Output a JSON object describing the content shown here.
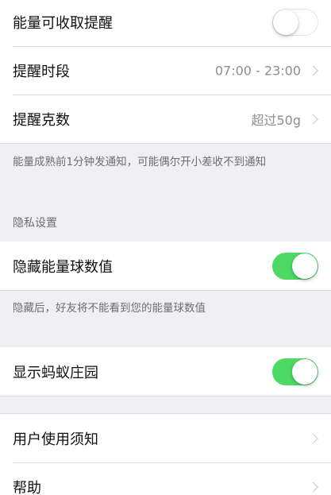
{
  "energy_section": {
    "reminder_label": "能量可收取提醒",
    "reminder_on": false,
    "time_label": "提醒时段",
    "time_value": "07:00 - 23:00",
    "grams_label": "提醒克数",
    "grams_value": "超过50g",
    "footnote": "能量成熟前1分钟发通知，可能偶尔开小差收不到通知"
  },
  "privacy_section": {
    "header": "隐私设置",
    "hide_label": "隐藏能量球数值",
    "hide_on": true,
    "footnote": "隐藏后，好友将不能看到您的能量球数值"
  },
  "manor_section": {
    "show_label": "显示蚂蚁庄园",
    "show_on": true
  },
  "info_section": {
    "terms_label": "用户使用须知",
    "help_label": "帮助"
  },
  "colors": {
    "switch_on": "#4cd964",
    "background": "#efeff4"
  }
}
